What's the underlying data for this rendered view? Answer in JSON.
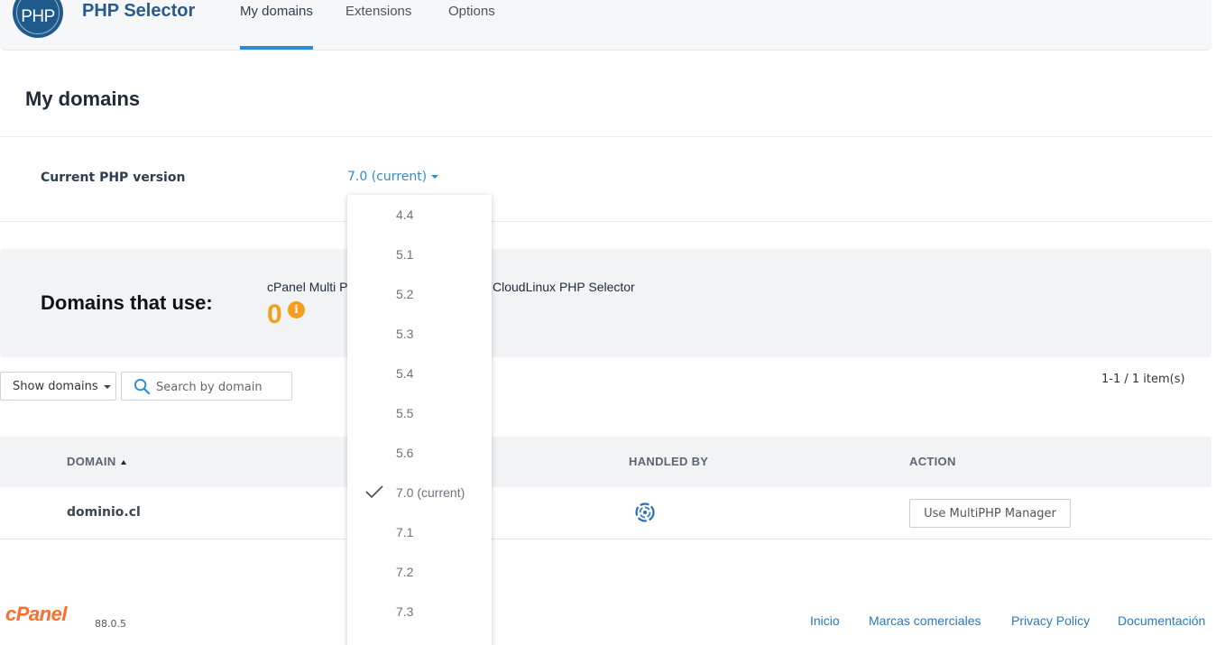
{
  "header": {
    "logo_text": "PHP",
    "app_title": "PHP Selector",
    "tabs": [
      {
        "label": "My domains",
        "active": true
      },
      {
        "label": "Extensions",
        "active": false
      },
      {
        "label": "Options",
        "active": false
      }
    ]
  },
  "page": {
    "title": "My domains",
    "php_version_label": "Current PHP version",
    "php_version_value": "7.0 (current)"
  },
  "summary": {
    "title": "Domains that use:",
    "cpanel_multiphp_text": "cPanel Multi P",
    "cloudlinux_text": "CloudLinux PHP Selector",
    "cpanel_count": "0",
    "info_glyph": "i"
  },
  "controls": {
    "show_domains_label": "Show domains",
    "search_placeholder": "Search by domain",
    "items_count": "1-1 / 1 item(s)"
  },
  "table": {
    "columns": [
      "DOMAIN",
      "HANDLED BY",
      "ACTION"
    ],
    "rows": [
      {
        "domain": "dominio.cl",
        "handled_by_icon": "cloudlinux-icon",
        "action": "Use MultiPHP Manager"
      }
    ]
  },
  "dropdown": {
    "options": [
      "4.4",
      "5.1",
      "5.2",
      "5.3",
      "5.4",
      "5.5",
      "5.6",
      "7.0 (current)",
      "7.1",
      "7.2",
      "7.3"
    ],
    "selected_index": 7
  },
  "footer": {
    "logo_text": "cPanel",
    "version": "88.0.5",
    "links": [
      "Inicio",
      "Marcas comerciales",
      "Privacy Policy",
      "Documentación"
    ]
  },
  "colors": {
    "accent": "#2f8bd1",
    "count": "#f59e1b",
    "cpanel_brand": "#ff6c2c"
  }
}
